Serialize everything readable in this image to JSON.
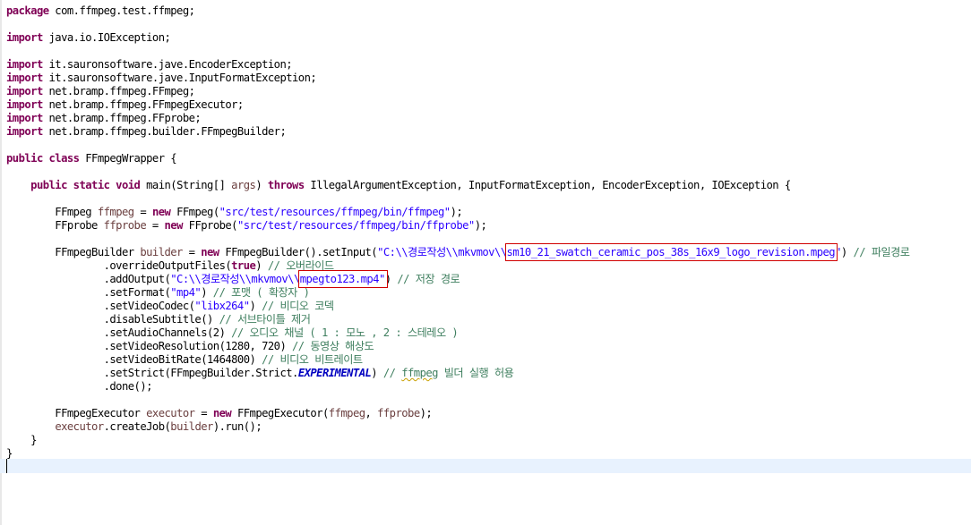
{
  "editor": {
    "highlight_color": "#d00000",
    "lines": [
      [
        {
          "t": "package",
          "c": "kw"
        },
        {
          "t": " com.ffmpeg.test.ffmpeg;"
        }
      ],
      [],
      [
        {
          "t": "import",
          "c": "kw"
        },
        {
          "t": " java.io.IOException;"
        }
      ],
      [],
      [
        {
          "t": "import",
          "c": "kw"
        },
        {
          "t": " it.sauronsoftware.jave.EncoderException;"
        }
      ],
      [
        {
          "t": "import",
          "c": "kw"
        },
        {
          "t": " it.sauronsoftware.jave.InputFormatException;"
        }
      ],
      [
        {
          "t": "import",
          "c": "kw"
        },
        {
          "t": " net.bramp.ffmpeg.FFmpeg;"
        }
      ],
      [
        {
          "t": "import",
          "c": "kw"
        },
        {
          "t": " net.bramp.ffmpeg.FFmpegExecutor;"
        }
      ],
      [
        {
          "t": "import",
          "c": "kw"
        },
        {
          "t": " net.bramp.ffmpeg.FFprobe;"
        }
      ],
      [
        {
          "t": "import",
          "c": "kw"
        },
        {
          "t": " net.bramp.ffmpeg.builder.FFmpegBuilder;"
        }
      ],
      [],
      [
        {
          "t": "public class",
          "c": "kw"
        },
        {
          "t": " FFmpegWrapper {"
        }
      ],
      [],
      [
        {
          "t": "    "
        },
        {
          "t": "public static void",
          "c": "kw"
        },
        {
          "t": " main(String[] "
        },
        {
          "t": "args",
          "c": "var"
        },
        {
          "t": ") "
        },
        {
          "t": "throws",
          "c": "kw"
        },
        {
          "t": " IllegalArgumentException, InputFormatException, EncoderException, IOException {"
        }
      ],
      [],
      [
        {
          "t": "        FFmpeg "
        },
        {
          "t": "ffmpeg",
          "c": "var"
        },
        {
          "t": " = "
        },
        {
          "t": "new",
          "c": "kw"
        },
        {
          "t": " FFmpeg("
        },
        {
          "t": "\"src/test/resources/ffmpeg/bin/ffmpeg\"",
          "c": "str"
        },
        {
          "t": ");"
        }
      ],
      [
        {
          "t": "        FFprobe "
        },
        {
          "t": "ffprobe",
          "c": "var"
        },
        {
          "t": " = "
        },
        {
          "t": "new",
          "c": "kw"
        },
        {
          "t": " FFprobe("
        },
        {
          "t": "\"src/test/resources/ffmpeg/bin/ffprobe\"",
          "c": "str"
        },
        {
          "t": ");"
        }
      ],
      [],
      [
        {
          "t": "        FFmpegBuilder "
        },
        {
          "t": "builder",
          "c": "var"
        },
        {
          "t": " = "
        },
        {
          "t": "new",
          "c": "kw"
        },
        {
          "t": " FFmpegBuilder().setInput("
        },
        {
          "t": "\"C:\\\\경로작성\\\\mkvmov\\\\",
          "c": "str"
        },
        {
          "t": "sm10_21_swatch_ceramic_pos_38s_16x9_logo_revision.mpeg",
          "c": "str",
          "box": "input-path-highlight-box"
        },
        {
          "t": "\"",
          "c": "str"
        },
        {
          "t": ") "
        },
        {
          "t": "// 파일경로",
          "c": "cm"
        }
      ],
      [
        {
          "t": "                .overrideOutputFiles("
        },
        {
          "t": "true",
          "c": "kw"
        },
        {
          "t": ") "
        },
        {
          "t": "// 오버라이드",
          "c": "cm"
        }
      ],
      [
        {
          "t": "                .addOutput("
        },
        {
          "t": "\"C:\\\\경로작성\\\\mkvmov\\\\",
          "c": "str"
        },
        {
          "t": "mpegto123.mp4\"",
          "c": "str",
          "box": "output-path-highlight-box"
        },
        {
          "t": ") "
        },
        {
          "t": "// 저장 경로",
          "c": "cm"
        }
      ],
      [
        {
          "t": "                .setFormat("
        },
        {
          "t": "\"mp4\"",
          "c": "str"
        },
        {
          "t": ") "
        },
        {
          "t": "// 포맷 ( 확장자 )",
          "c": "cm"
        }
      ],
      [
        {
          "t": "                .setVideoCodec("
        },
        {
          "t": "\"libx264\"",
          "c": "str"
        },
        {
          "t": ") "
        },
        {
          "t": "// 비디오 코덱",
          "c": "cm"
        }
      ],
      [
        {
          "t": "                .disableSubtitle() "
        },
        {
          "t": "// 서브타이틀 제거",
          "c": "cm"
        }
      ],
      [
        {
          "t": "                .setAudioChannels(2) "
        },
        {
          "t": "// 오디오 채널 ( 1 : 모노 , 2 : 스테레오 )",
          "c": "cm"
        }
      ],
      [
        {
          "t": "                .setVideoResolution(1280, 720) "
        },
        {
          "t": "// 동영상 해상도",
          "c": "cm"
        }
      ],
      [
        {
          "t": "                .setVideoBitRate(1464800) "
        },
        {
          "t": "// 비디오 비트레이트",
          "c": "cm"
        }
      ],
      [
        {
          "t": "                .setStrict(FFmpegBuilder.Strict."
        },
        {
          "t": "EXPERIMENTAL",
          "c": "const"
        },
        {
          "t": ") "
        },
        {
          "t": "// ",
          "c": "cm"
        },
        {
          "t": "ffmpeg",
          "c": "cm squig"
        },
        {
          "t": " 빌더 실행 허용",
          "c": "cm"
        }
      ],
      [
        {
          "t": "                .done();"
        }
      ],
      [],
      [
        {
          "t": "        FFmpegExecutor "
        },
        {
          "t": "executor",
          "c": "var"
        },
        {
          "t": " = "
        },
        {
          "t": "new",
          "c": "kw"
        },
        {
          "t": " FFmpegExecutor("
        },
        {
          "t": "ffmpeg",
          "c": "var"
        },
        {
          "t": ", "
        },
        {
          "t": "ffprobe",
          "c": "var"
        },
        {
          "t": ");"
        }
      ],
      [
        {
          "t": "        "
        },
        {
          "t": "executor",
          "c": "var"
        },
        {
          "t": ".createJob("
        },
        {
          "t": "builder",
          "c": "var"
        },
        {
          "t": ").run();"
        }
      ],
      [
        {
          "t": "    }"
        }
      ],
      [
        {
          "t": "}"
        }
      ],
      []
    ]
  }
}
